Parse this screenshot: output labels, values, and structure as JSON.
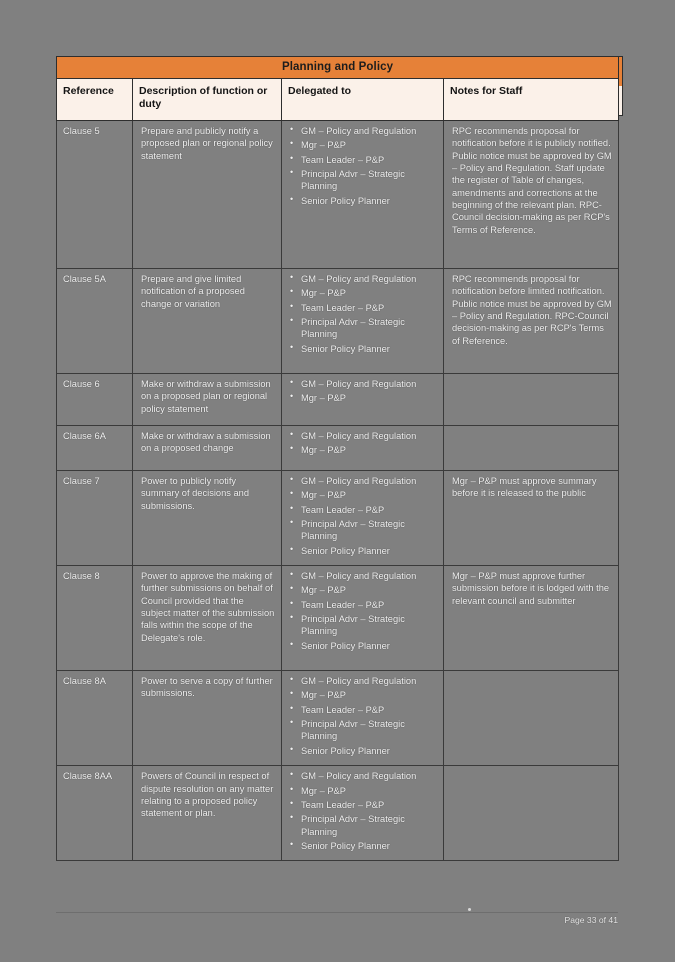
{
  "document": {
    "table_title": "Planning and Policy",
    "footer_text": "Page 33 of 41"
  },
  "table": {
    "columns": [
      {
        "key": "reference",
        "label": "Reference"
      },
      {
        "key": "description",
        "label": "Description of function or duty"
      },
      {
        "key": "delegated_to",
        "label": "Delegated to"
      },
      {
        "key": "notes",
        "label": "Notes for Staff"
      }
    ],
    "rows": [
      {
        "reference": "Clause 5",
        "description": "Prepare and publicly notify a proposed plan or regional policy statement",
        "delegated_to": [
          "GM – Policy and Regulation",
          "Mgr – P&P",
          "Team Leader – P&P",
          "Principal Advr – Strategic Planning",
          "Senior Policy Planner"
        ],
        "notes": "RPC recommends proposal for notification before it is publicly notified. Public notice must be approved by GM – Policy and Regulation. Staff update the register of Table of changes, amendments and corrections at the beginning of the relevant plan. RPC-Council decision-making as per RCP's Terms of Reference."
      },
      {
        "reference": "Clause 5A",
        "description": "Prepare and give limited notification of a proposed change or variation",
        "delegated_to": [
          "GM – Policy and Regulation",
          "Mgr – P&P",
          "Team Leader – P&P",
          "Principal Advr – Strategic Planning",
          "Senior Policy Planner"
        ],
        "notes": "RPC recommends proposal for notification before limited notification. Public notice must be approved by GM – Policy and Regulation. RPC-Council decision-making as per RCP's Terms of Reference."
      },
      {
        "reference": "Clause 6",
        "description": "Make or withdraw a submission on a proposed plan or regional policy statement",
        "delegated_to": [
          "GM – Policy and Regulation",
          "Mgr – P&P"
        ],
        "notes": ""
      },
      {
        "reference": "Clause 6A",
        "description": "Make or withdraw a submission on a proposed change",
        "delegated_to": [
          "GM – Policy and Regulation",
          "Mgr – P&P"
        ],
        "notes": ""
      },
      {
        "reference": "Clause 7",
        "description": "Power to publicly notify summary of decisions and submissions.",
        "delegated_to": [
          "GM – Policy and Regulation",
          "Mgr – P&P",
          "Team Leader – P&P",
          "Principal Advr – Strategic Planning",
          "Senior Policy Planner"
        ],
        "notes": "Mgr – P&P must approve summary before it is released to the public"
      },
      {
        "reference": "Clause 8",
        "description": "Power to approve the making of further submissions on behalf of Council provided that the subject matter of the submission falls within the scope of the Delegate's role.",
        "delegated_to": [
          "GM – Policy and Regulation",
          "Mgr – P&P",
          "Team Leader – P&P",
          "Principal Advr – Strategic Planning",
          "Senior Policy Planner"
        ],
        "notes": "Mgr – P&P must approve further submission before it is lodged with the relevant council and submitter"
      },
      {
        "reference": "Clause 8A",
        "description": "Power to serve a copy of further submissions.",
        "delegated_to": [
          "GM – Policy and Regulation",
          "Mgr – P&P",
          "Team Leader – P&P",
          "Principal Advr – Strategic Planning",
          "Senior Policy Planner"
        ],
        "notes": ""
      },
      {
        "reference": "Clause 8AA",
        "description": "Powers of Council in respect of dispute resolution on any matter relating to a proposed policy statement or plan.",
        "delegated_to": [
          "GM – Policy and Regulation",
          "Mgr – P&P",
          "Team Leader – P&P",
          "Principal Advr – Strategic Planning",
          "Senior Policy Planner"
        ],
        "notes": ""
      }
    ]
  },
  "colors": {
    "title_band": "#E68138",
    "header_band": "#FBF1E9",
    "page_background": "#808080",
    "border": "#2e2e2e"
  }
}
